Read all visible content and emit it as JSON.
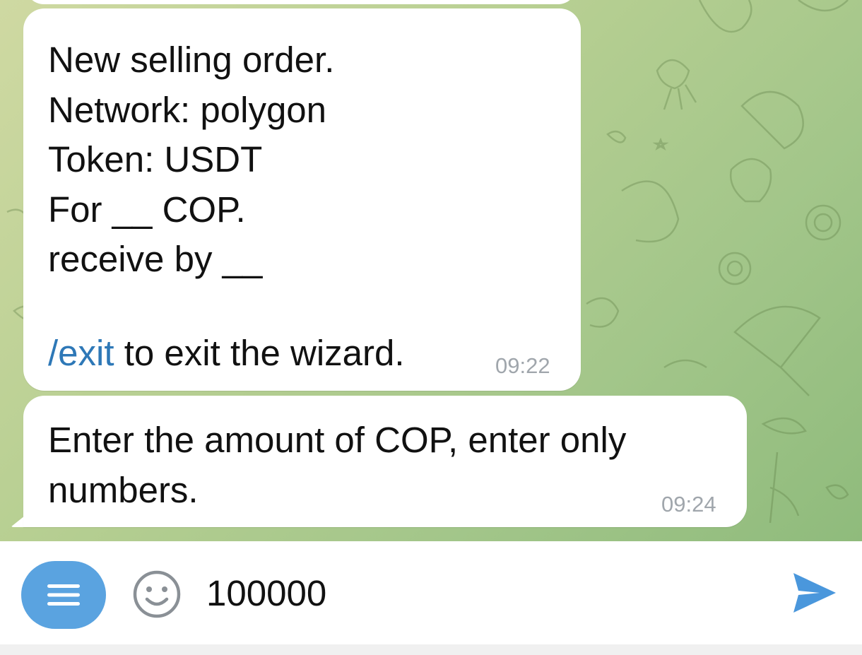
{
  "messages": [
    {
      "lines": "New selling order.\nNetwork: polygon\nToken: USDT\nFor __ COP.\nreceive by __",
      "command": "/exit",
      "command_suffix": " to exit the wizard.",
      "time": "09:22"
    },
    {
      "lines": "Enter the amount of COP, enter only\nnumbers.",
      "time": "09:24"
    }
  ],
  "composer": {
    "input_value": "100000",
    "menu_icon": "menu-icon",
    "emoji_icon": "smile-icon",
    "send_icon": "send-icon"
  },
  "colors": {
    "accent": "#5aa3e0",
    "link": "#2e78b7",
    "timestamp": "#a0a6ac"
  }
}
